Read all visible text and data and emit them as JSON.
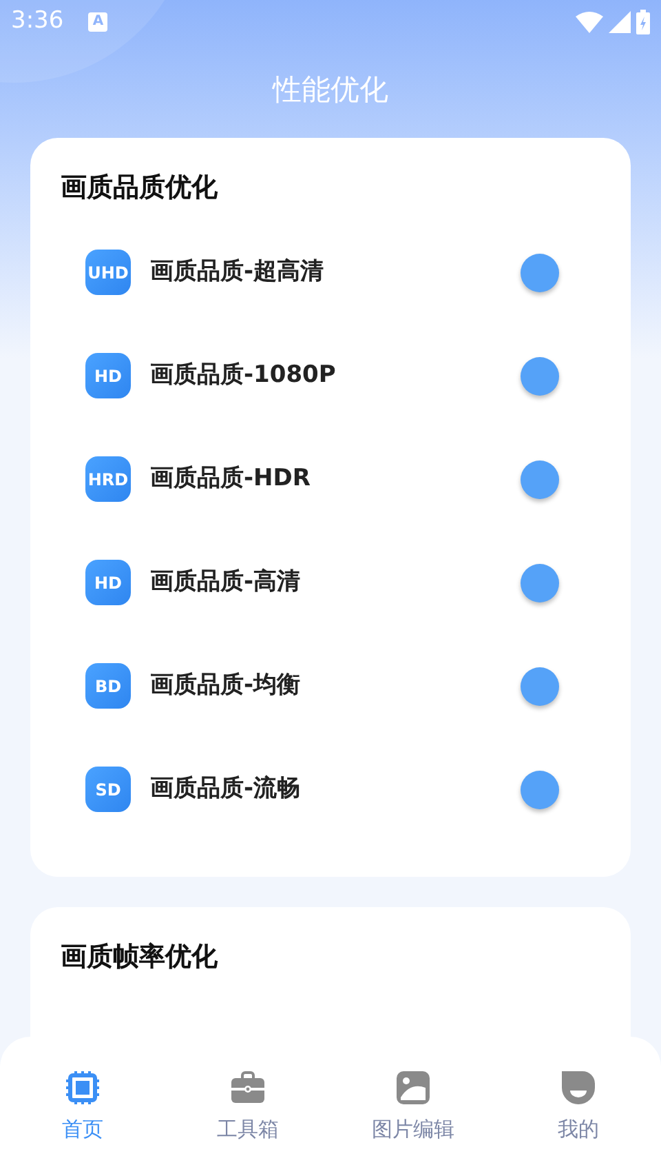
{
  "status_bar": {
    "time": "3:36",
    "notification": "A"
  },
  "title": "性能优化",
  "sections": [
    {
      "title": "画质品质优化",
      "items": [
        {
          "badge": "UHD",
          "label": "画质品质-超高清",
          "on": false
        },
        {
          "badge": "HD",
          "label": "画质品质-1080P",
          "on": false
        },
        {
          "badge": "HRD",
          "label": "画质品质-HDR",
          "on": false
        },
        {
          "badge": "HD",
          "label": "画质品质-高清",
          "on": false
        },
        {
          "badge": "BD",
          "label": "画质品质-均衡",
          "on": false
        },
        {
          "badge": "SD",
          "label": "画质品质-流畅",
          "on": false
        }
      ]
    },
    {
      "title": "画质帧率优化"
    }
  ],
  "nav": [
    {
      "label": "首页",
      "kind": "chip",
      "selected": true
    },
    {
      "label": "工具箱",
      "kind": "toolbox",
      "selected": false
    },
    {
      "label": "图片编辑",
      "kind": "image",
      "selected": false
    },
    {
      "label": "我的",
      "kind": "face",
      "selected": false
    }
  ]
}
